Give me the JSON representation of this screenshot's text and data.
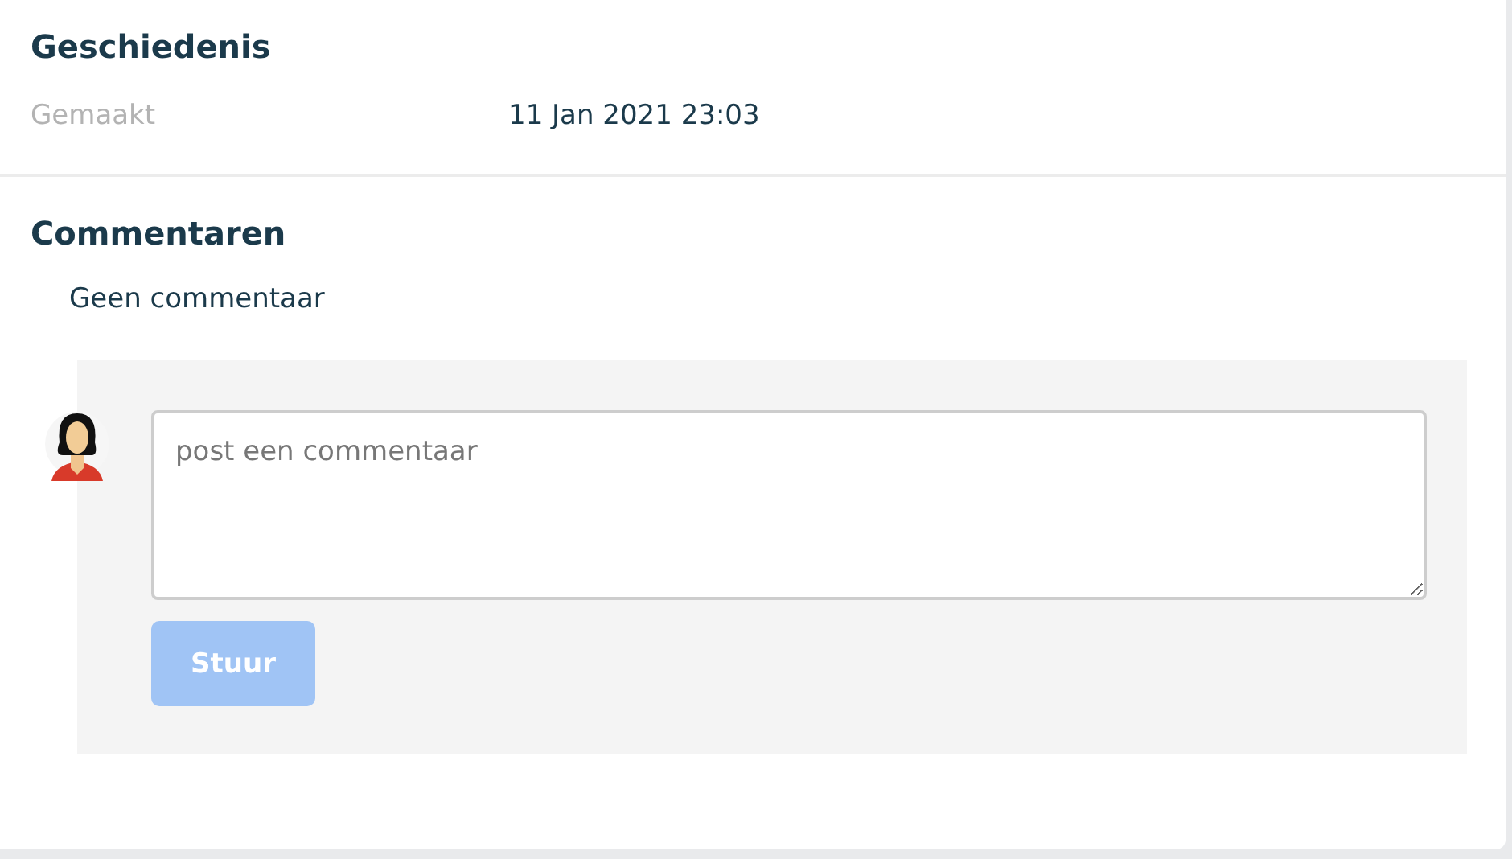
{
  "history": {
    "title": "Geschiedenis",
    "rows": [
      {
        "label": "Gemaakt",
        "value": "11 Jan 2021 23:03"
      }
    ]
  },
  "comments": {
    "title": "Commentaren",
    "empty_text": "Geen commentaar",
    "form": {
      "placeholder": "post een commentaar",
      "button": {
        "label": "Stuur",
        "disabled": true
      }
    }
  }
}
